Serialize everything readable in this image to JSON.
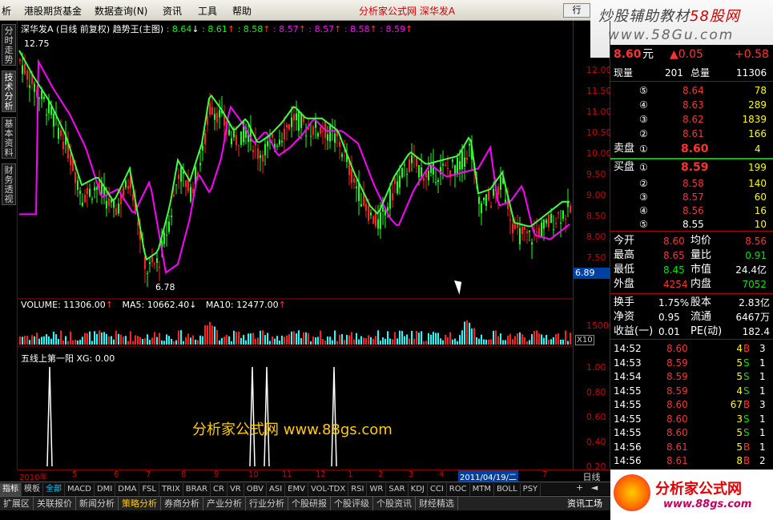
{
  "menubar": {
    "items": [
      "析",
      "港股期货基金",
      "数据查询",
      "资讯",
      "工具",
      "帮助"
    ],
    "query_hotkey": "(N)",
    "title": "分析家公式网  深华发A",
    "trade_button": "行 "
  },
  "brand": {
    "line1a": "炒股辅助教材",
    "line1b": "58股网",
    "line2": "www.58Gu.com"
  },
  "sidetabs": [
    "分时走势",
    "技术分析",
    "基本资料",
    "财务透视"
  ],
  "chart": {
    "header_stock": "深华发A",
    "header_mode": "(日线 前复权)",
    "header_indicator": "趋势王(主图)",
    "header_values": [
      ": 8.64",
      ": 8.61",
      ": 8.58",
      ": 8.57",
      ": 8.57",
      ": 8.58",
      ": 8.59"
    ],
    "high_label": "12.75",
    "low_label": "6.78",
    "watermark": "分析家公式网  www.88gs.com",
    "volume_header": {
      "vol": "VOLUME: 11306.00",
      "ma5": "MA5: 10662.40",
      "ma10": "MA10: 12477.00"
    },
    "sub_header": "五线上第一阳  XG: 0.00",
    "cursor_price": "6.89"
  },
  "price_axis": [
    "12.00",
    "11.50",
    "11.00",
    "10.50",
    "10.00",
    "9.50",
    "9.00",
    "8.50",
    "8.00",
    "7.50"
  ],
  "vol_axis": {
    "value": "15000",
    "mult": "X10"
  },
  "sub_axis": [
    "1.00",
    "0.80",
    "0.60",
    "0.40",
    "0.20"
  ],
  "dates": {
    "year": "2010年",
    "months": [
      "5",
      "6",
      "7",
      "8",
      "9",
      "10",
      "11",
      "12",
      "1",
      "2",
      "3",
      "4"
    ],
    "selected": "2011/04/19/二",
    "last": "7"
  },
  "period": "日线",
  "quote": {
    "price": "8.60",
    "unit": "元",
    "change": "▲0.05",
    "change_pct": "+0.58",
    "current_vol_label": "现量",
    "current_vol": "201",
    "total_vol_label": "总量",
    "total_vol": "11306",
    "asks": [
      {
        "lvl": "⑤",
        "price": "8.64",
        "vol": "78"
      },
      {
        "lvl": "④",
        "price": "8.63",
        "vol": "289"
      },
      {
        "lvl": "③",
        "price": "8.62",
        "vol": "1839"
      },
      {
        "lvl": "②",
        "price": "8.61",
        "vol": "166"
      }
    ],
    "ask1": {
      "label": "卖盘",
      "lvl": "①",
      "price": "8.60",
      "vol": "4"
    },
    "bid1": {
      "label": "买盘",
      "lvl": "①",
      "price": "8.59",
      "vol": "199"
    },
    "bids": [
      {
        "lvl": "②",
        "price": "8.58",
        "vol": "140"
      },
      {
        "lvl": "③",
        "price": "8.57",
        "vol": "60"
      },
      {
        "lvl": "④",
        "price": "8.56",
        "vol": "16"
      },
      {
        "lvl": "⑤",
        "price": "8.55",
        "vol": "10"
      }
    ],
    "stats": [
      {
        "l1": "今开",
        "v1": "8.60",
        "l2": "均价",
        "v2": "8.56"
      },
      {
        "l1": "最高",
        "v1": "8.65",
        "l2": "量比",
        "v2": "0.91"
      },
      {
        "l1": "最低",
        "v1": "8.45",
        "l2": "市值",
        "v2": "24.4亿"
      },
      {
        "l1": "外盘",
        "v1": "4254",
        "l2": "内盘",
        "v2": "7052"
      }
    ],
    "fund": [
      {
        "l1": "换手",
        "v1": "1.75%",
        "l2": "股本",
        "v2": "2.83亿"
      },
      {
        "l1": "净资",
        "v1": "0.95",
        "l2": "流通",
        "v2": "6467万"
      },
      {
        "l1": "收益(一)",
        "v1": "0.01",
        "l2": "PE(动)",
        "v2": "182.4"
      }
    ],
    "ticks": [
      {
        "t": "14:52",
        "p": "8.60",
        "v": "4",
        "d": "B",
        "n": "3"
      },
      {
        "t": "14:53",
        "p": "8.59",
        "v": "5",
        "d": "S",
        "n": "1"
      },
      {
        "t": "14:54",
        "p": "8.59",
        "v": "5",
        "d": "S",
        "n": "1"
      },
      {
        "t": "14:55",
        "p": "8.59",
        "v": "4",
        "d": "S",
        "n": "1"
      },
      {
        "t": "14:55",
        "p": "8.60",
        "v": "67",
        "d": "B",
        "n": "3"
      },
      {
        "t": "14:55",
        "p": "8.60",
        "v": "3",
        "d": "S",
        "n": "1"
      },
      {
        "t": "14:55",
        "p": "8.60",
        "v": "5",
        "d": "S",
        "n": "1"
      },
      {
        "t": "14:56",
        "p": "8.61",
        "v": "5",
        "d": "B",
        "n": "1"
      },
      {
        "t": "14:56",
        "p": "8.61",
        "v": "8",
        "d": "B",
        "n": "2"
      }
    ]
  },
  "indicator_tabs": [
    "指标",
    "模板",
    "全部",
    "MACD",
    "DMI",
    "DMA",
    "FSL",
    "TRIX",
    "BRAR",
    "CR",
    "VR",
    "OBV",
    "ASI",
    "EMV",
    "VOL-TDX",
    "RSI",
    "WR",
    "SAR",
    "KDJ",
    "CCI",
    "ROC",
    "MTM",
    "BOLL",
    "PSY"
  ],
  "bottom_menu": [
    "扩展区",
    "关联报价",
    "新闻分析",
    "策略分析",
    "券商分析",
    "产业分析",
    "行业分析",
    "个股研报",
    "个股评级",
    "个股资讯",
    "财经精选"
  ],
  "bottom_right": "资讯工场",
  "logo": {
    "text": "分析家公式网",
    "url": "www.88gs.com"
  }
}
